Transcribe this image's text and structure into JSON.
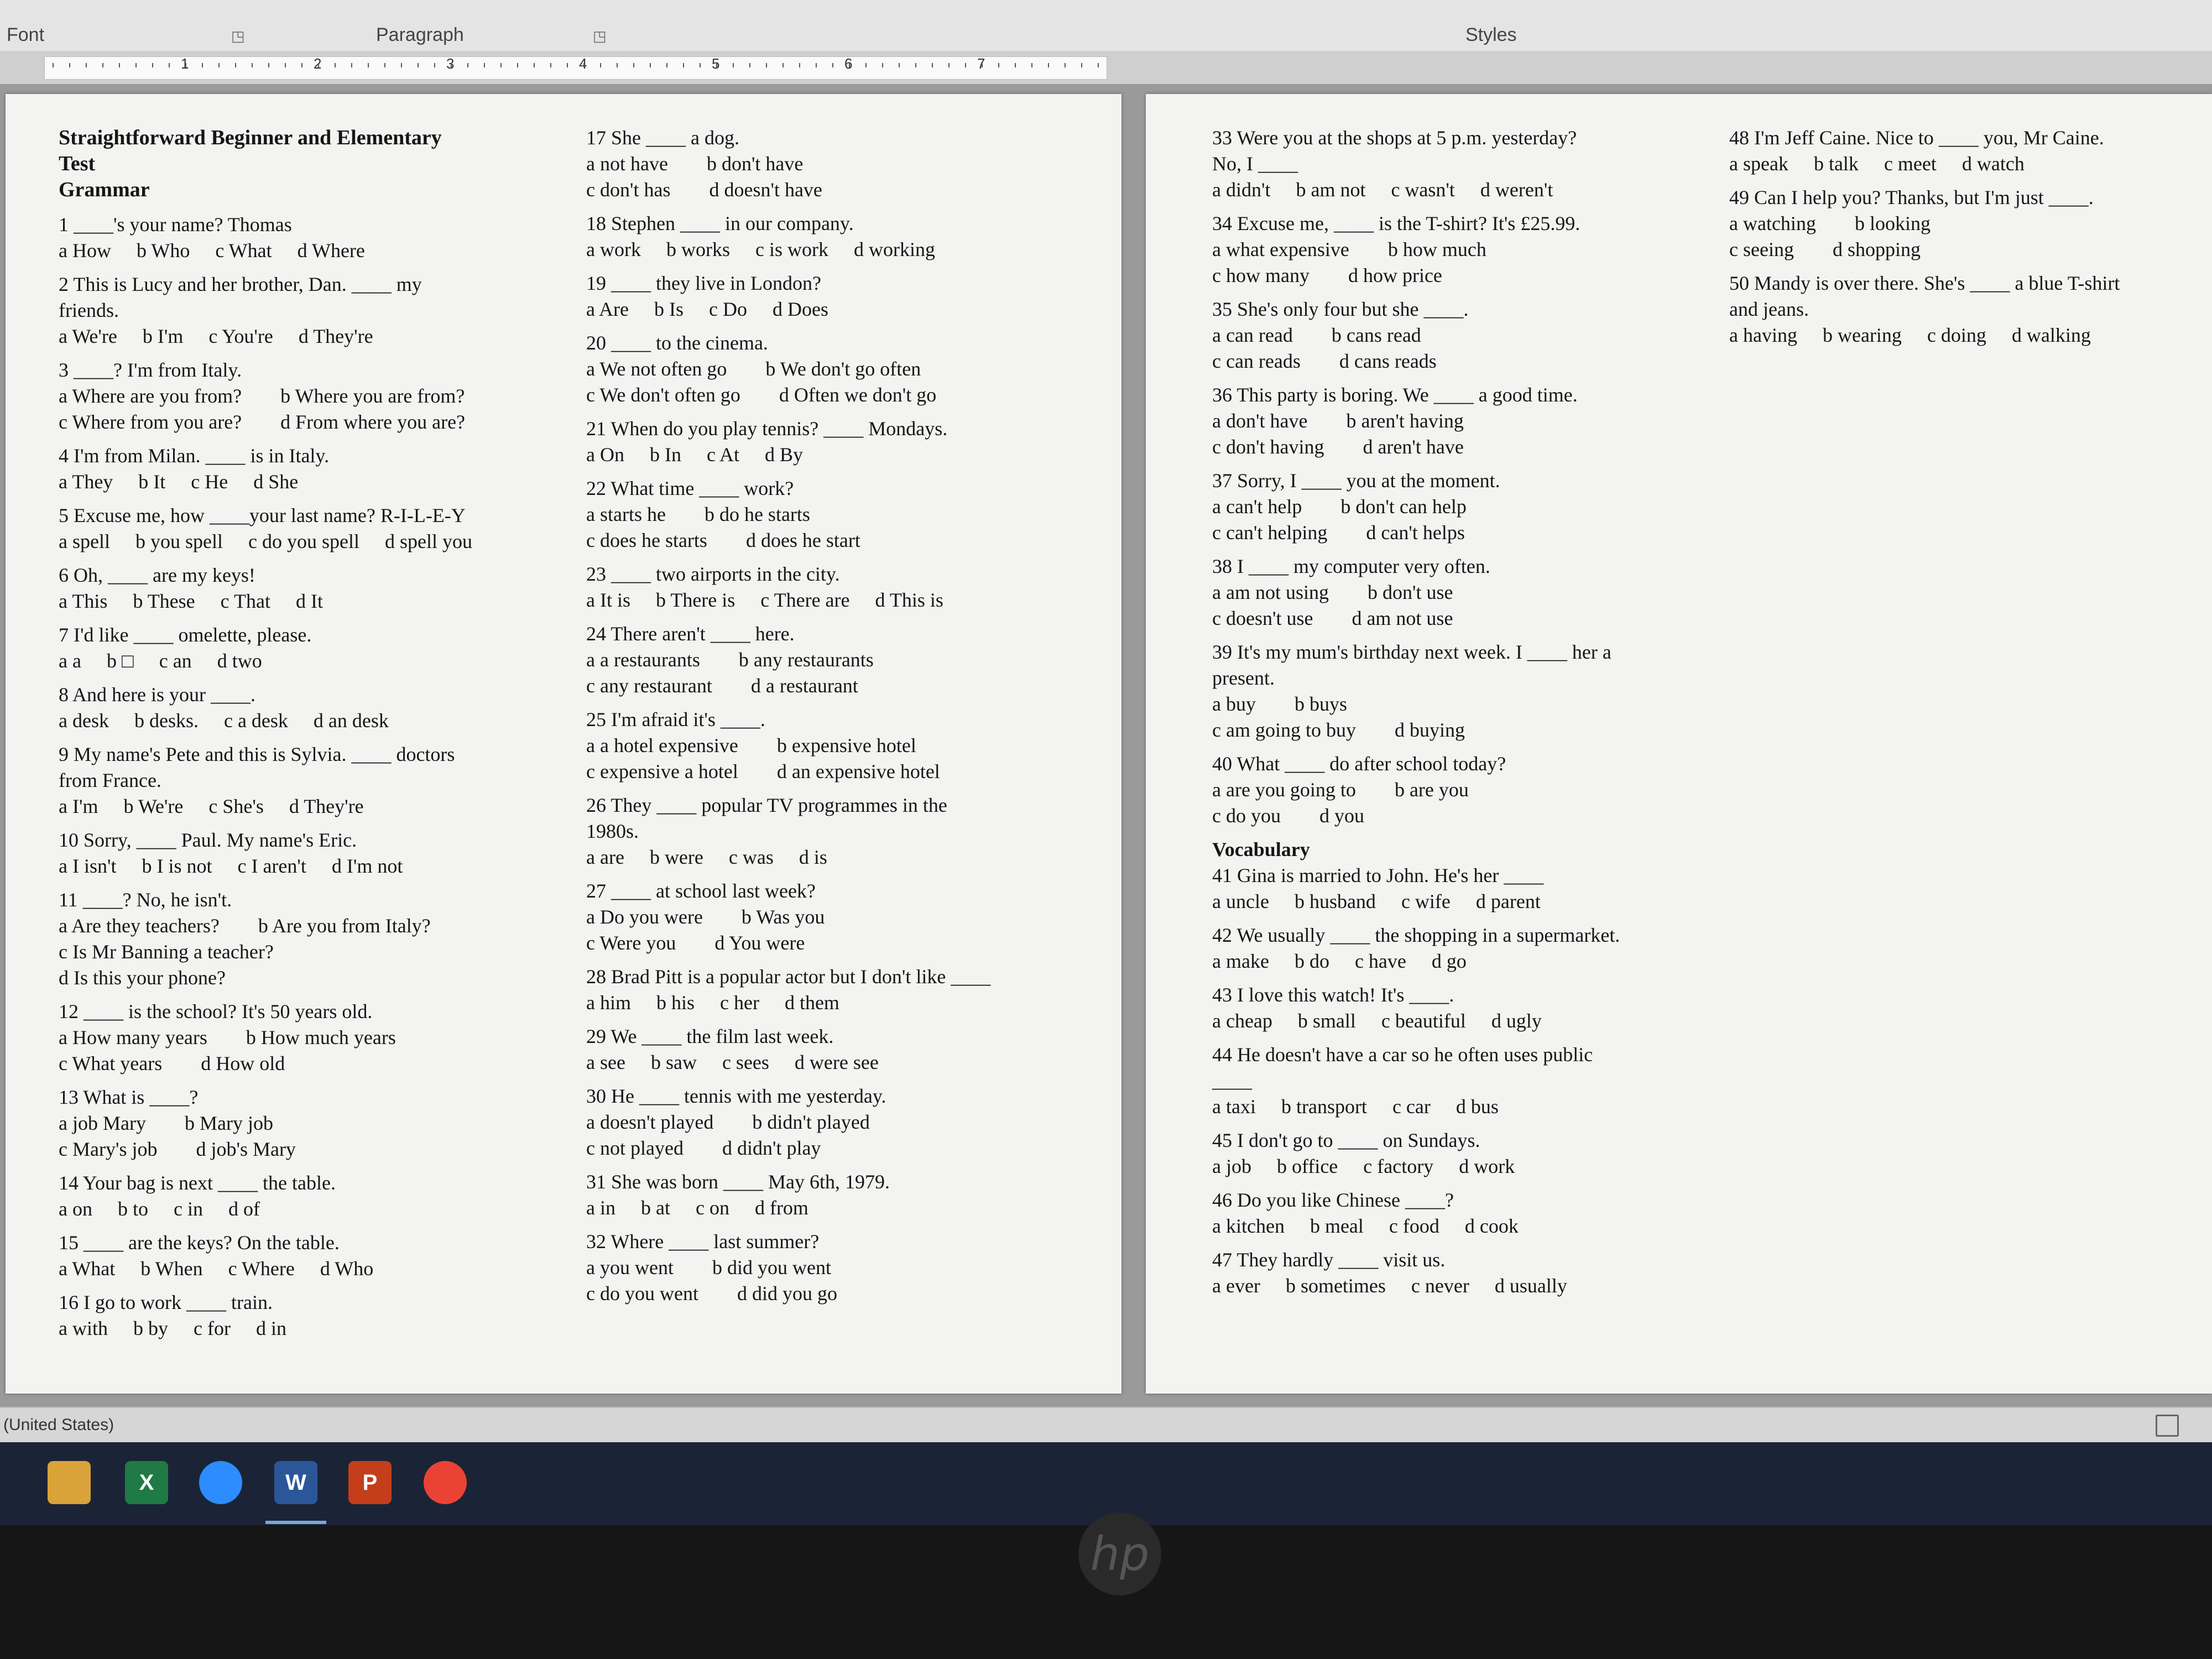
{
  "ribbon": {
    "font_label": "Font",
    "paragraph_label": "Paragraph",
    "styles_label": "Styles",
    "launcher_icon": "dialog-launcher-icon"
  },
  "ruler": {
    "numbers": [
      "1",
      "2",
      "3",
      "4",
      "5",
      "6",
      "7"
    ]
  },
  "page1": {
    "col1": {
      "heading": [
        "Straightforward Beginner and Elementary",
        "Test",
        "Grammar"
      ],
      "questions": [
        {
          "q": [
            "1 ____'s your name? Thomas"
          ],
          "opts": [
            [
              "a How",
              "b Who",
              "c What",
              "d Where"
            ]
          ]
        },
        {
          "q": [
            "2 This is Lucy and her brother, Dan. ____ my",
            "friends."
          ],
          "opts": [
            [
              "a We're",
              "b I'm",
              "c You're",
              "d They're"
            ]
          ]
        },
        {
          "q": [
            "3 ____? I'm from Italy."
          ],
          "opts": [
            [
              "a Where are you from?",
              "b Where you are from?"
            ],
            [
              "c Where from you are?",
              "d From where you are?"
            ]
          ]
        },
        {
          "q": [
            "4 I'm from Milan. ____ is in Italy."
          ],
          "opts": [
            [
              "a They",
              "b It",
              "c He",
              "d She"
            ]
          ]
        },
        {
          "q": [
            "5 Excuse me, how ____your last name? R-I-L-E-Y"
          ],
          "opts": [
            [
              "a spell",
              "b you spell",
              "c do you spell",
              "d spell you"
            ]
          ]
        },
        {
          "q": [
            "6 Oh, ____ are my keys!"
          ],
          "opts": [
            [
              "a This",
              "b These",
              "c That",
              "d It"
            ]
          ]
        },
        {
          "q": [
            "7 I'd like ____ omelette, please."
          ],
          "opts": [
            [
              "a a",
              "b □",
              "c an",
              "d two"
            ]
          ]
        },
        {
          "q": [
            "8 And here is your ____."
          ],
          "opts": [
            [
              "a desk",
              "b desks.",
              "c a desk",
              "d an desk"
            ]
          ]
        },
        {
          "q": [
            "9 My name's Pete and this is Sylvia. ____ doctors",
            "from France."
          ],
          "opts": [
            [
              "a I'm",
              "b We're",
              "c She's",
              "d They're"
            ]
          ]
        },
        {
          "q": [
            "10 Sorry, ____ Paul. My name's Eric."
          ],
          "opts": [
            [
              "a I isn't",
              "b I is not",
              "c I aren't",
              "d I'm not"
            ]
          ]
        },
        {
          "q": [
            "11 ____? No, he isn't."
          ],
          "opts": [
            [
              "a Are they teachers?",
              "b Are you from Italy?"
            ],
            [
              "c Is Mr Banning a teacher?"
            ],
            [
              "d Is this your phone?"
            ]
          ]
        },
        {
          "q": [
            "12 ____ is the school? It's 50 years old."
          ],
          "opts": [
            [
              "a How many years",
              "b How much years"
            ],
            [
              "c What years",
              "d How old"
            ]
          ]
        },
        {
          "q": [
            "13 What is ____?"
          ],
          "opts": [
            [
              "a job Mary",
              "b Mary job"
            ],
            [
              "c Mary's job",
              "d job's Mary"
            ]
          ]
        },
        {
          "q": [
            "14 Your bag is next ____ the table."
          ],
          "opts": [
            [
              "a on",
              "b to",
              "c in",
              "d of"
            ]
          ]
        },
        {
          "q": [
            "15 ____ are the keys? On the table."
          ],
          "opts": [
            [
              "a What",
              "b When",
              "c Where",
              "d Who"
            ]
          ]
        },
        {
          "q": [
            "16 I go to work ____ train."
          ],
          "opts": [
            [
              "a with",
              "b by",
              "c for",
              "d in"
            ]
          ]
        }
      ]
    },
    "col2": {
      "questions": [
        {
          "q": [
            "17 She ____ a dog."
          ],
          "opts": [
            [
              "a not have",
              "b don't have"
            ],
            [
              "c don't has",
              "d doesn't have"
            ]
          ]
        },
        {
          "q": [
            "18 Stephen ____ in our company."
          ],
          "opts": [
            [
              "a work",
              "b works",
              "c is work",
              "d working"
            ]
          ]
        },
        {
          "q": [
            "19 ____ they live in London?"
          ],
          "opts": [
            [
              "a Are",
              "b Is",
              "c Do",
              "d Does"
            ]
          ]
        },
        {
          "q": [
            "20 ____ to the cinema."
          ],
          "opts": [
            [
              "a We not often go",
              "b We don't go often"
            ],
            [
              "c We don't often go",
              "d Often we don't go"
            ]
          ]
        },
        {
          "q": [
            "21 When do you play tennis? ____ Mondays."
          ],
          "opts": [
            [
              "a On",
              "b In",
              "c At",
              "d By"
            ]
          ]
        },
        {
          "q": [
            "22 What time ____ work?"
          ],
          "opts": [
            [
              "a starts he",
              "b do he starts"
            ],
            [
              "c does he starts",
              "d does he start"
            ]
          ]
        },
        {
          "q": [
            "23 ____ two airports in the city."
          ],
          "opts": [
            [
              "a It is",
              "b There is",
              "c There are",
              "d This is"
            ]
          ]
        },
        {
          "q": [
            "24 There aren't ____ here."
          ],
          "opts": [
            [
              "a a restaurants",
              "b any restaurants"
            ],
            [
              "c any restaurant",
              "d a restaurant"
            ]
          ]
        },
        {
          "q": [
            "25 I'm afraid it's ____."
          ],
          "opts": [
            [
              "a a hotel expensive",
              "b expensive hotel"
            ],
            [
              "c expensive a hotel",
              "d an expensive hotel"
            ]
          ]
        },
        {
          "q": [
            "26 They ____ popular TV programmes in the",
            "1980s."
          ],
          "opts": [
            [
              "a are",
              "b were",
              "c was",
              "d is"
            ]
          ]
        },
        {
          "q": [
            "27 ____ at school last week?"
          ],
          "opts": [
            [
              "a Do you were",
              "b Was you"
            ],
            [
              "c Were you",
              "d You were"
            ]
          ]
        },
        {
          "q": [
            "28 Brad Pitt is a popular actor but I don't like ____"
          ],
          "opts": [
            [
              "a him",
              "b his",
              "c her",
              "d them"
            ]
          ]
        },
        {
          "q": [
            "29 We ____ the film last week."
          ],
          "opts": [
            [
              "a see",
              "b saw",
              "c sees",
              "d were see"
            ]
          ]
        },
        {
          "q": [
            "30 He ____ tennis with me yesterday."
          ],
          "opts": [
            [
              "a doesn't played",
              "b didn't played"
            ],
            [
              "c not played",
              "d didn't play"
            ]
          ]
        },
        {
          "q": [
            "31 She was born ____ May 6th, 1979."
          ],
          "opts": [
            [
              "a in",
              "b at",
              "c on",
              "d from"
            ]
          ]
        },
        {
          "q": [
            "32 Where ____ last summer?"
          ],
          "opts": [
            [
              "a you went",
              "b did you went"
            ],
            [
              "c do you went",
              "d did you go"
            ]
          ]
        }
      ]
    }
  },
  "page2": {
    "col3": {
      "questions": [
        {
          "q": [
            "33 Were you at the shops at 5 p.m. yesterday?",
            "No, I ____"
          ],
          "opts": [
            [
              "a didn't",
              "b am not",
              "c wasn't",
              "d weren't"
            ]
          ]
        },
        {
          "q": [
            "34 Excuse me, ____ is the T-shirt? It's £25.99."
          ],
          "opts": [
            [
              "a what expensive",
              "b how much"
            ],
            [
              "c how many",
              "d how price"
            ]
          ]
        },
        {
          "q": [
            "35 She's only four but she ____."
          ],
          "opts": [
            [
              "a can read",
              "b cans read"
            ],
            [
              "c can reads",
              "d cans reads"
            ]
          ]
        },
        {
          "q": [
            "36 This party is boring. We ____ a good time."
          ],
          "opts": [
            [
              "a don't have",
              "b aren't having"
            ],
            [
              "c don't having",
              "d aren't have"
            ]
          ]
        },
        {
          "q": [
            "37 Sorry, I ____ you at the moment."
          ],
          "opts": [
            [
              "a can't help",
              "b don't can help"
            ],
            [
              "c can't helping",
              "d can't helps"
            ]
          ]
        },
        {
          "q": [
            "38 I ____ my computer very often."
          ],
          "opts": [
            [
              "a am not using",
              "b don't use"
            ],
            [
              "c doesn't use",
              "d am not use"
            ]
          ]
        },
        {
          "q": [
            "39 It's my mum's birthday next week. I ____ her a",
            "present."
          ],
          "opts": [
            [
              "a buy",
              "b buys"
            ],
            [
              "c am going to buy",
              "d buying"
            ]
          ]
        },
        {
          "q": [
            "40 What ____ do after school today?"
          ],
          "opts": [
            [
              "a are you going to",
              "b are you"
            ],
            [
              "c do you",
              "d you"
            ]
          ]
        }
      ],
      "vocab_heading": "Vocabulary",
      "vocab": [
        {
          "q": [
            "41 Gina is married to John. He's her ____"
          ],
          "opts": [
            [
              "a uncle",
              "b husband",
              "c wife",
              "d parent"
            ]
          ]
        },
        {
          "q": [
            "42 We usually ____ the shopping in a supermarket."
          ],
          "opts": [
            [
              "a make",
              "b do",
              "c have",
              "d go"
            ]
          ]
        },
        {
          "q": [
            "43 I love this watch! It's ____."
          ],
          "opts": [
            [
              "a cheap",
              "b small",
              "c beautiful",
              "d ugly"
            ]
          ]
        },
        {
          "q": [
            "44 He doesn't have a car so he often uses public",
            "____"
          ],
          "opts": [
            [
              "a taxi",
              "b transport",
              "c car",
              "d bus"
            ]
          ]
        },
        {
          "q": [
            "45 I don't go to ____ on Sundays."
          ],
          "opts": [
            [
              "a job",
              "b office",
              "c factory",
              "d work"
            ]
          ]
        },
        {
          "q": [
            "46 Do you like Chinese ____?"
          ],
          "opts": [
            [
              "a kitchen",
              "b meal",
              "c food",
              "d cook"
            ]
          ]
        },
        {
          "q": [
            "47 They hardly ____ visit us."
          ],
          "opts": [
            [
              "a ever",
              "b sometimes",
              "c never",
              "d usually"
            ]
          ]
        }
      ]
    },
    "col4": {
      "questions": [
        {
          "q": [
            "48 I'm Jeff Caine. Nice to ____ you, Mr Caine."
          ],
          "opts": [
            [
              "a speak",
              "b talk",
              "c meet",
              "d watch"
            ]
          ]
        },
        {
          "q": [
            "49 Can I help you? Thanks, but I'm just ____."
          ],
          "opts": [
            [
              "a watching",
              "b looking"
            ],
            [
              "c seeing",
              "d shopping"
            ]
          ]
        },
        {
          "q": [
            "50 Mandy is over there. She's ____ a blue T-shirt",
            "and jeans."
          ],
          "opts": [
            [
              "a having",
              "b wearing",
              "c doing",
              "d walking"
            ]
          ]
        }
      ]
    }
  },
  "statusbar": {
    "language": "(United States)",
    "read_mode_icon": "book-icon"
  },
  "taskbar": {
    "icons": [
      {
        "name": "store-icon",
        "label": "",
        "color": "#d9a33a"
      },
      {
        "name": "excel-icon",
        "label": "X",
        "color": "#1f7a45"
      },
      {
        "name": "zoom-icon",
        "label": "",
        "color": "#2d8cff"
      },
      {
        "name": "word-icon",
        "label": "W",
        "color": "#2b579a"
      },
      {
        "name": "powerpoint-icon",
        "label": "P",
        "color": "#c43e1c"
      },
      {
        "name": "chrome-icon",
        "label": "",
        "color": "#ea4335"
      }
    ]
  },
  "monitor": {
    "logo": "hp"
  }
}
